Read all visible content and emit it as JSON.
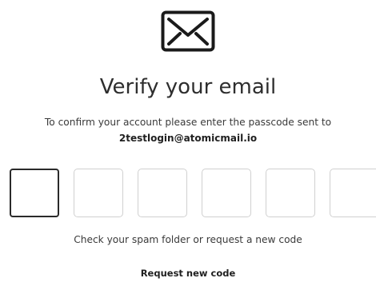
{
  "header": {
    "icon": "envelope-icon",
    "title": "Verify your email"
  },
  "instructions": {
    "text": "To confirm your account please enter the passcode sent to",
    "email": "2testlogin@atomicmail.io"
  },
  "passcode": {
    "digits": [
      "",
      "",
      "",
      "",
      "",
      ""
    ],
    "active_index": 0
  },
  "footer": {
    "hint": "Check your spam folder or request a new code",
    "request_label": "Request new code"
  },
  "colors": {
    "text": "#2e2e2e",
    "box_border": "#d0d0d0",
    "active_border": "#2a2a2a"
  }
}
